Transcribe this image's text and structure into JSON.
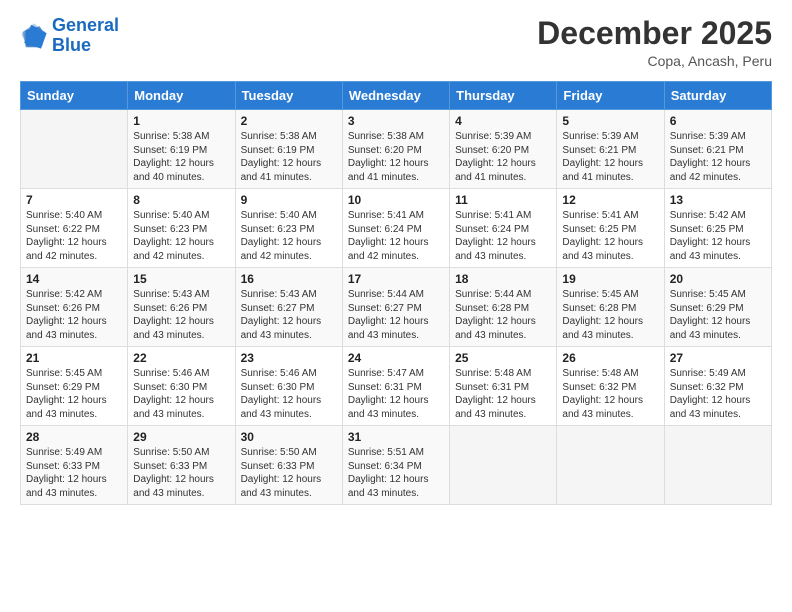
{
  "logo": {
    "line1": "General",
    "line2": "Blue"
  },
  "title": "December 2025",
  "location": "Copa, Ancash, Peru",
  "header_days": [
    "Sunday",
    "Monday",
    "Tuesday",
    "Wednesday",
    "Thursday",
    "Friday",
    "Saturday"
  ],
  "weeks": [
    [
      {
        "day": "",
        "sunrise": "",
        "sunset": "",
        "daylight": ""
      },
      {
        "day": "1",
        "sunrise": "Sunrise: 5:38 AM",
        "sunset": "Sunset: 6:19 PM",
        "daylight": "Daylight: 12 hours and 40 minutes."
      },
      {
        "day": "2",
        "sunrise": "Sunrise: 5:38 AM",
        "sunset": "Sunset: 6:19 PM",
        "daylight": "Daylight: 12 hours and 41 minutes."
      },
      {
        "day": "3",
        "sunrise": "Sunrise: 5:38 AM",
        "sunset": "Sunset: 6:20 PM",
        "daylight": "Daylight: 12 hours and 41 minutes."
      },
      {
        "day": "4",
        "sunrise": "Sunrise: 5:39 AM",
        "sunset": "Sunset: 6:20 PM",
        "daylight": "Daylight: 12 hours and 41 minutes."
      },
      {
        "day": "5",
        "sunrise": "Sunrise: 5:39 AM",
        "sunset": "Sunset: 6:21 PM",
        "daylight": "Daylight: 12 hours and 41 minutes."
      },
      {
        "day": "6",
        "sunrise": "Sunrise: 5:39 AM",
        "sunset": "Sunset: 6:21 PM",
        "daylight": "Daylight: 12 hours and 42 minutes."
      }
    ],
    [
      {
        "day": "7",
        "sunrise": "Sunrise: 5:40 AM",
        "sunset": "Sunset: 6:22 PM",
        "daylight": "Daylight: 12 hours and 42 minutes."
      },
      {
        "day": "8",
        "sunrise": "Sunrise: 5:40 AM",
        "sunset": "Sunset: 6:23 PM",
        "daylight": "Daylight: 12 hours and 42 minutes."
      },
      {
        "day": "9",
        "sunrise": "Sunrise: 5:40 AM",
        "sunset": "Sunset: 6:23 PM",
        "daylight": "Daylight: 12 hours and 42 minutes."
      },
      {
        "day": "10",
        "sunrise": "Sunrise: 5:41 AM",
        "sunset": "Sunset: 6:24 PM",
        "daylight": "Daylight: 12 hours and 42 minutes."
      },
      {
        "day": "11",
        "sunrise": "Sunrise: 5:41 AM",
        "sunset": "Sunset: 6:24 PM",
        "daylight": "Daylight: 12 hours and 43 minutes."
      },
      {
        "day": "12",
        "sunrise": "Sunrise: 5:41 AM",
        "sunset": "Sunset: 6:25 PM",
        "daylight": "Daylight: 12 hours and 43 minutes."
      },
      {
        "day": "13",
        "sunrise": "Sunrise: 5:42 AM",
        "sunset": "Sunset: 6:25 PM",
        "daylight": "Daylight: 12 hours and 43 minutes."
      }
    ],
    [
      {
        "day": "14",
        "sunrise": "Sunrise: 5:42 AM",
        "sunset": "Sunset: 6:26 PM",
        "daylight": "Daylight: 12 hours and 43 minutes."
      },
      {
        "day": "15",
        "sunrise": "Sunrise: 5:43 AM",
        "sunset": "Sunset: 6:26 PM",
        "daylight": "Daylight: 12 hours and 43 minutes."
      },
      {
        "day": "16",
        "sunrise": "Sunrise: 5:43 AM",
        "sunset": "Sunset: 6:27 PM",
        "daylight": "Daylight: 12 hours and 43 minutes."
      },
      {
        "day": "17",
        "sunrise": "Sunrise: 5:44 AM",
        "sunset": "Sunset: 6:27 PM",
        "daylight": "Daylight: 12 hours and 43 minutes."
      },
      {
        "day": "18",
        "sunrise": "Sunrise: 5:44 AM",
        "sunset": "Sunset: 6:28 PM",
        "daylight": "Daylight: 12 hours and 43 minutes."
      },
      {
        "day": "19",
        "sunrise": "Sunrise: 5:45 AM",
        "sunset": "Sunset: 6:28 PM",
        "daylight": "Daylight: 12 hours and 43 minutes."
      },
      {
        "day": "20",
        "sunrise": "Sunrise: 5:45 AM",
        "sunset": "Sunset: 6:29 PM",
        "daylight": "Daylight: 12 hours and 43 minutes."
      }
    ],
    [
      {
        "day": "21",
        "sunrise": "Sunrise: 5:45 AM",
        "sunset": "Sunset: 6:29 PM",
        "daylight": "Daylight: 12 hours and 43 minutes."
      },
      {
        "day": "22",
        "sunrise": "Sunrise: 5:46 AM",
        "sunset": "Sunset: 6:30 PM",
        "daylight": "Daylight: 12 hours and 43 minutes."
      },
      {
        "day": "23",
        "sunrise": "Sunrise: 5:46 AM",
        "sunset": "Sunset: 6:30 PM",
        "daylight": "Daylight: 12 hours and 43 minutes."
      },
      {
        "day": "24",
        "sunrise": "Sunrise: 5:47 AM",
        "sunset": "Sunset: 6:31 PM",
        "daylight": "Daylight: 12 hours and 43 minutes."
      },
      {
        "day": "25",
        "sunrise": "Sunrise: 5:48 AM",
        "sunset": "Sunset: 6:31 PM",
        "daylight": "Daylight: 12 hours and 43 minutes."
      },
      {
        "day": "26",
        "sunrise": "Sunrise: 5:48 AM",
        "sunset": "Sunset: 6:32 PM",
        "daylight": "Daylight: 12 hours and 43 minutes."
      },
      {
        "day": "27",
        "sunrise": "Sunrise: 5:49 AM",
        "sunset": "Sunset: 6:32 PM",
        "daylight": "Daylight: 12 hours and 43 minutes."
      }
    ],
    [
      {
        "day": "28",
        "sunrise": "Sunrise: 5:49 AM",
        "sunset": "Sunset: 6:33 PM",
        "daylight": "Daylight: 12 hours and 43 minutes."
      },
      {
        "day": "29",
        "sunrise": "Sunrise: 5:50 AM",
        "sunset": "Sunset: 6:33 PM",
        "daylight": "Daylight: 12 hours and 43 minutes."
      },
      {
        "day": "30",
        "sunrise": "Sunrise: 5:50 AM",
        "sunset": "Sunset: 6:33 PM",
        "daylight": "Daylight: 12 hours and 43 minutes."
      },
      {
        "day": "31",
        "sunrise": "Sunrise: 5:51 AM",
        "sunset": "Sunset: 6:34 PM",
        "daylight": "Daylight: 12 hours and 43 minutes."
      },
      {
        "day": "",
        "sunrise": "",
        "sunset": "",
        "daylight": ""
      },
      {
        "day": "",
        "sunrise": "",
        "sunset": "",
        "daylight": ""
      },
      {
        "day": "",
        "sunrise": "",
        "sunset": "",
        "daylight": ""
      }
    ]
  ]
}
